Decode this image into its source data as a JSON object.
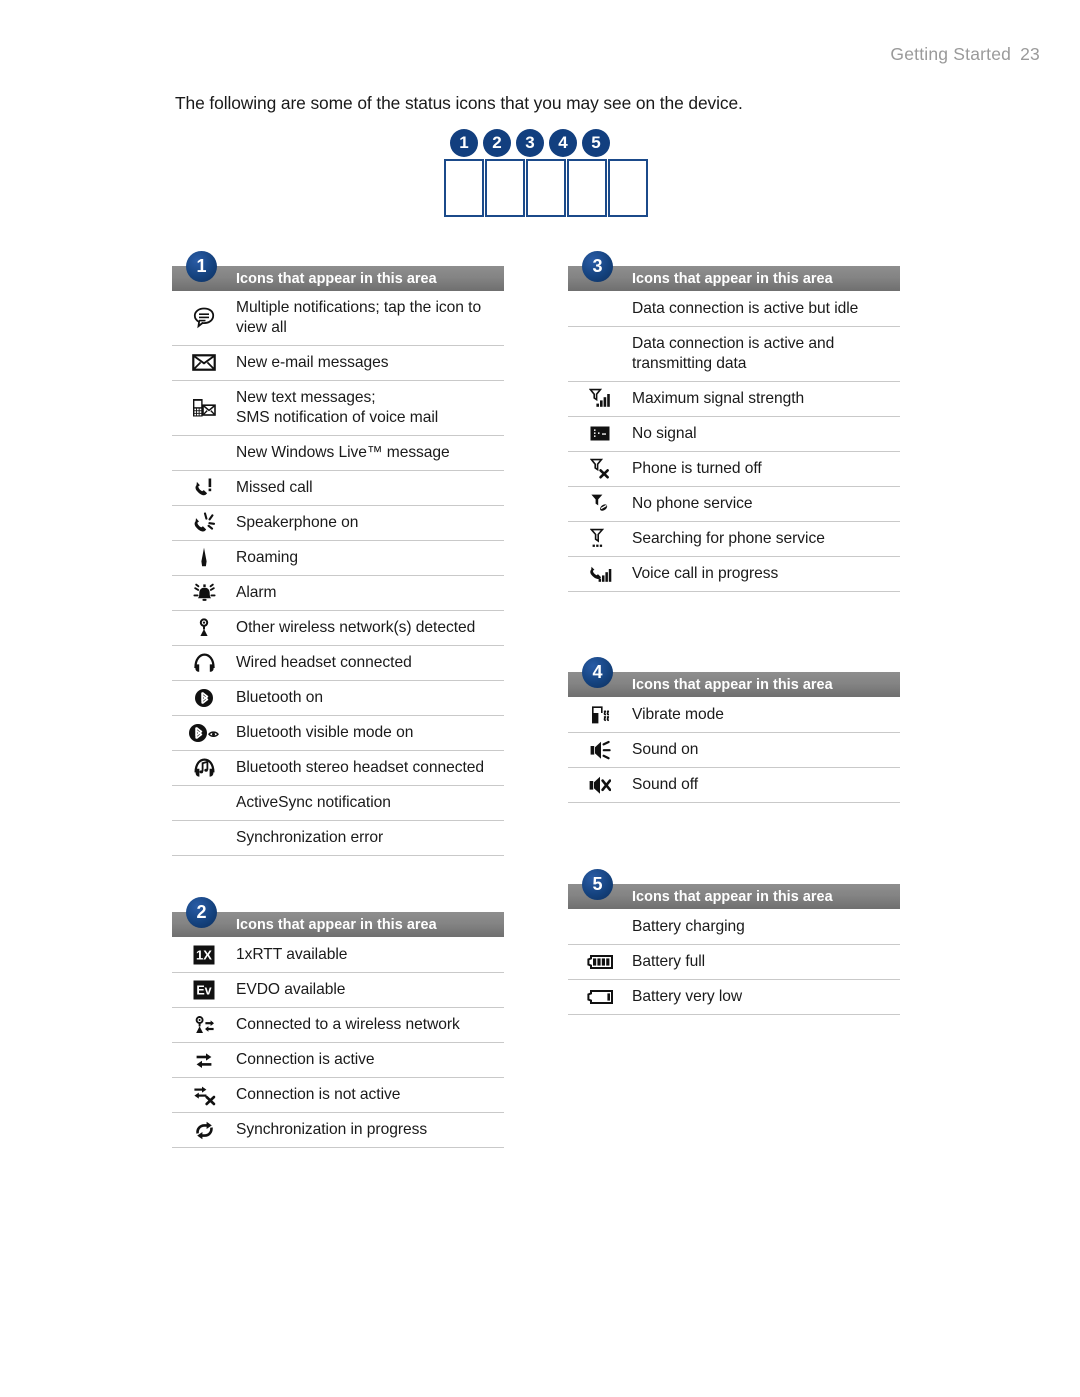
{
  "header": {
    "chapter": "Getting Started",
    "page_number": "23"
  },
  "intro": "The following are some of the status icons that you may see on the device.",
  "diagram": {
    "badges": [
      "1",
      "2",
      "3",
      "4",
      "5"
    ],
    "boxes": 5
  },
  "section_header_label": "Icons that appear in this area",
  "sections": [
    {
      "number": "1",
      "title": "Icons that appear in this area",
      "rows": [
        {
          "icon": "multiple-notifications-icon",
          "label": "Multiple notifications; tap the icon to",
          "label2": "view all"
        },
        {
          "icon": "new-email-icon",
          "label": "New e-mail messages"
        },
        {
          "icon": "new-text-message-icon",
          "label": "New text messages;",
          "label2": "SMS notification of voice mail"
        },
        {
          "icon": "none",
          "label": "New Windows Live™ message"
        },
        {
          "icon": "missed-call-icon",
          "label": "Missed call"
        },
        {
          "icon": "speakerphone-icon",
          "label": "Speakerphone on"
        },
        {
          "icon": "roaming-icon",
          "label": "Roaming"
        },
        {
          "icon": "alarm-icon",
          "label": "Alarm"
        },
        {
          "icon": "wireless-network-detected-icon",
          "label": "Other wireless network(s) detected"
        },
        {
          "icon": "wired-headset-icon",
          "label": "Wired headset connected"
        },
        {
          "icon": "bluetooth-on-icon",
          "label": "Bluetooth on"
        },
        {
          "icon": "bluetooth-visible-icon",
          "label": "Bluetooth visible mode on"
        },
        {
          "icon": "bluetooth-stereo-headset-icon",
          "label": "Bluetooth stereo headset connected"
        },
        {
          "icon": "none",
          "label": "ActiveSync notification"
        },
        {
          "icon": "none",
          "label": "Synchronization error"
        }
      ]
    },
    {
      "number": "2",
      "title": "Icons that appear in this area",
      "rows": [
        {
          "icon": "one-x-rtt-icon",
          "label": "1xRTT available"
        },
        {
          "icon": "evdo-icon",
          "label": "EVDO available"
        },
        {
          "icon": "connected-wireless-network-icon",
          "label": "Connected to a wireless network"
        },
        {
          "icon": "connection-active-icon",
          "label": "Connection is active"
        },
        {
          "icon": "connection-not-active-icon",
          "label": "Connection is not active"
        },
        {
          "icon": "sync-in-progress-icon",
          "label": "Synchronization in progress"
        }
      ]
    },
    {
      "number": "3",
      "title": "Icons that appear in this area",
      "rows": [
        {
          "icon": "none",
          "label": "Data connection is active but idle"
        },
        {
          "icon": "none",
          "label": "Data connection is active and",
          "label2": "transmitting data"
        },
        {
          "icon": "max-signal-strength-icon",
          "label": "Maximum signal strength"
        },
        {
          "icon": "no-signal-icon",
          "label": "No signal"
        },
        {
          "icon": "phone-off-icon",
          "label": "Phone is turned off"
        },
        {
          "icon": "no-phone-service-icon",
          "label": "No phone service"
        },
        {
          "icon": "searching-phone-service-icon",
          "label": "Searching for phone service"
        },
        {
          "icon": "voice-call-in-progress-icon",
          "label": "Voice call in progress"
        }
      ]
    },
    {
      "number": "4",
      "title": "Icons that appear in this area",
      "rows": [
        {
          "icon": "vibrate-mode-icon",
          "label": "Vibrate mode"
        },
        {
          "icon": "sound-on-icon",
          "label": "Sound on"
        },
        {
          "icon": "sound-off-icon",
          "label": "Sound off"
        }
      ]
    },
    {
      "number": "5",
      "title": "Icons that appear in this area",
      "rows": [
        {
          "icon": "none",
          "label": "Battery charging"
        },
        {
          "icon": "battery-full-icon",
          "label": "Battery full"
        },
        {
          "icon": "battery-very-low-icon",
          "label": "Battery very low"
        }
      ]
    }
  ],
  "colors": {
    "badge_blue": "#123f7f",
    "header_gray": "#808080",
    "rule_gray": "#c9c9c9",
    "page_header_gray": "#9a9a9a",
    "text_black": "#1a1a1a",
    "box_outline_blue": "#1b4a8a"
  }
}
